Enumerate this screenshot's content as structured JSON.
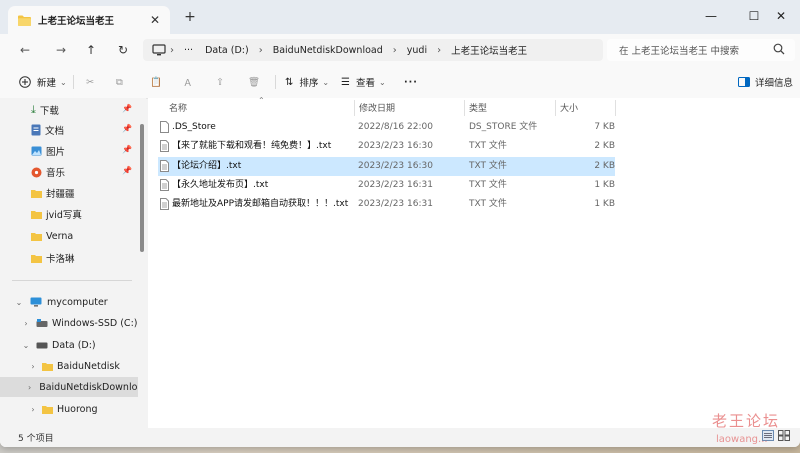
{
  "tab": {
    "title": "上老王论坛当老王",
    "close": "✕",
    "new_tab": "+"
  },
  "window_controls": {
    "minimize": "—",
    "maximize": "☐",
    "close": "✕"
  },
  "nav": {
    "back": "←",
    "forward": "→",
    "up": "↑",
    "refresh": "↻"
  },
  "address": {
    "more": "···",
    "crumbs": [
      "Data (D:)",
      "BaiduNetdiskDownload",
      "yudi",
      "上老王论坛当老王"
    ]
  },
  "search": {
    "placeholder": "在 上老王论坛当老王 中搜索"
  },
  "toolbar": {
    "new_label": "新建",
    "sort_label": "排序",
    "view_label": "查看",
    "more": "···",
    "details_label": "详细信息"
  },
  "sidebar": {
    "quick": [
      {
        "label": "下载",
        "icon": "download-icon"
      },
      {
        "label": "文档",
        "icon": "document-icon"
      },
      {
        "label": "图片",
        "icon": "picture-icon"
      },
      {
        "label": "音乐",
        "icon": "music-icon"
      },
      {
        "label": "封疆疆",
        "icon": "folder-icon"
      },
      {
        "label": "jvid写真",
        "icon": "folder-icon"
      },
      {
        "label": "Verna",
        "icon": "folder-icon"
      },
      {
        "label": "卡洛琳",
        "icon": "folder-icon"
      }
    ],
    "tree": [
      {
        "label": "mycomputer",
        "icon": "computer-icon"
      },
      {
        "label": "Windows-SSD (C:)",
        "icon": "drive-icon"
      },
      {
        "label": "Data (D:)",
        "icon": "drive-icon"
      },
      {
        "label": "BaiduNetdisk",
        "icon": "folder-icon"
      },
      {
        "label": "BaiduNetdiskDownload",
        "icon": "folder-icon"
      },
      {
        "label": "Huorong",
        "icon": "folder-icon"
      }
    ]
  },
  "columns": {
    "name": "名称",
    "date": "修改日期",
    "type": "类型",
    "size": "大小"
  },
  "files": [
    {
      "name": ".DS_Store",
      "date": "2022/8/16 22:00",
      "type": "DS_STORE 文件",
      "size": "7 KB"
    },
    {
      "name": "【来了就能下载和观看！纯免费！】.txt",
      "date": "2023/2/23 16:30",
      "type": "TXT 文件",
      "size": "2 KB"
    },
    {
      "name": "【论坛介绍】.txt",
      "date": "2023/2/23 16:30",
      "type": "TXT 文件",
      "size": "2 KB"
    },
    {
      "name": "【永久地址发布页】.txt",
      "date": "2023/2/23 16:31",
      "type": "TXT 文件",
      "size": "1 KB"
    },
    {
      "name": "最新地址及APP请发邮箱自动获取！！！.txt",
      "date": "2023/2/23 16:31",
      "type": "TXT 文件",
      "size": "1 KB"
    }
  ],
  "status": {
    "count": "5 个项目"
  },
  "watermark": {
    "text": "老王论坛",
    "url": "laowang..."
  },
  "colors": {
    "accent": "#0067c0",
    "selection": "#cce8ff",
    "folder": "#f3c443"
  }
}
